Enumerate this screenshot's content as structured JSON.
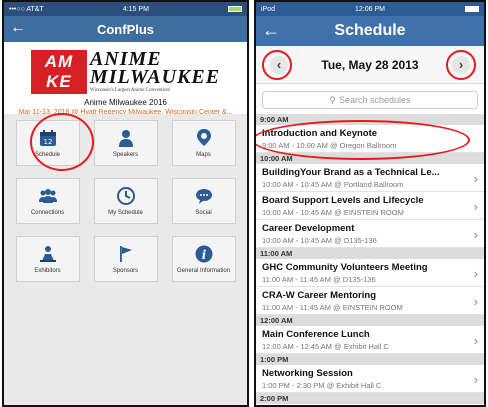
{
  "left": {
    "status": {
      "carrier": "•••○○ AT&T",
      "time": "4:15 PM"
    },
    "nav": {
      "title": "ConfPlus"
    },
    "banner": {
      "logo_text": "AM KE",
      "name_line1": "ANIME",
      "name_line2": "MILWAUKEE",
      "tagline": "Wisconsin's Largest Anime Convention!"
    },
    "event_name": "Anime Milwaukee 2016",
    "event_info": "Mar 11-13, 2016 @ Hyatt Regency Milwaukee, Wisconsin Center &...",
    "tiles": [
      {
        "label": "Schedule",
        "icon": "calendar-icon"
      },
      {
        "label": "Speakers",
        "icon": "person-icon"
      },
      {
        "label": "Maps",
        "icon": "map-pin-icon"
      },
      {
        "label": "Connections",
        "icon": "people-icon"
      },
      {
        "label": "My Schedule",
        "icon": "clock-icon"
      },
      {
        "label": "Social",
        "icon": "chat-bubble-icon"
      },
      {
        "label": "Exhibitors",
        "icon": "exhibitor-icon"
      },
      {
        "label": "Sponsors",
        "icon": "flag-icon"
      },
      {
        "label": "General Information",
        "icon": "info-icon"
      }
    ]
  },
  "right": {
    "status": {
      "carrier": "iPod",
      "time": "12:06 PM"
    },
    "nav": {
      "title": "Schedule"
    },
    "date": "Tue, May 28 2013",
    "search_placeholder": "Search schedules",
    "groups": [
      {
        "time": "9:00 AM",
        "items": [
          {
            "title": "Introduction and Keynote",
            "sub": "9:00 AM - 10:00 AM @ Oregon Ballroom"
          }
        ]
      },
      {
        "time": "10:00 AM",
        "items": [
          {
            "title": "BuildingYour Brand as a Technical Le...",
            "sub": "10:00 AM - 10:45 AM @ Portland Ballroom"
          },
          {
            "title": "Board Support Levels and Lifecycle",
            "sub": "10:00 AM - 10:45 AM @ EINSTEIN ROOM"
          },
          {
            "title": "Career Development",
            "sub": "10:00 AM - 10:45 AM @ D135-136"
          }
        ]
      },
      {
        "time": "11:00 AM",
        "items": [
          {
            "title": "GHC Community Volunteers Meeting",
            "sub": "11:00 AM - 11:45 AM @ D135-136"
          },
          {
            "title": "CRA-W Career Mentoring",
            "sub": "11:00 AM - 11:45 AM @ EINSTEIN ROOM"
          }
        ]
      },
      {
        "time": "12:00 AM",
        "items": [
          {
            "title": "Main Conference Lunch",
            "sub": "12:00 AM - 12:45 AM @ Exhibit Hall C"
          }
        ]
      },
      {
        "time": "1:00 PM",
        "items": [
          {
            "title": "Networking Session",
            "sub": "1:00 PM - 2:30 PM @ Exhibit Hall C"
          }
        ]
      },
      {
        "time": "2:00 PM",
        "items": []
      }
    ]
  },
  "colors": {
    "nav_dark": "#3f6d9f",
    "accent_red": "#e8181c",
    "logo_red": "#d71f26",
    "info_orange": "#d46a1d"
  }
}
